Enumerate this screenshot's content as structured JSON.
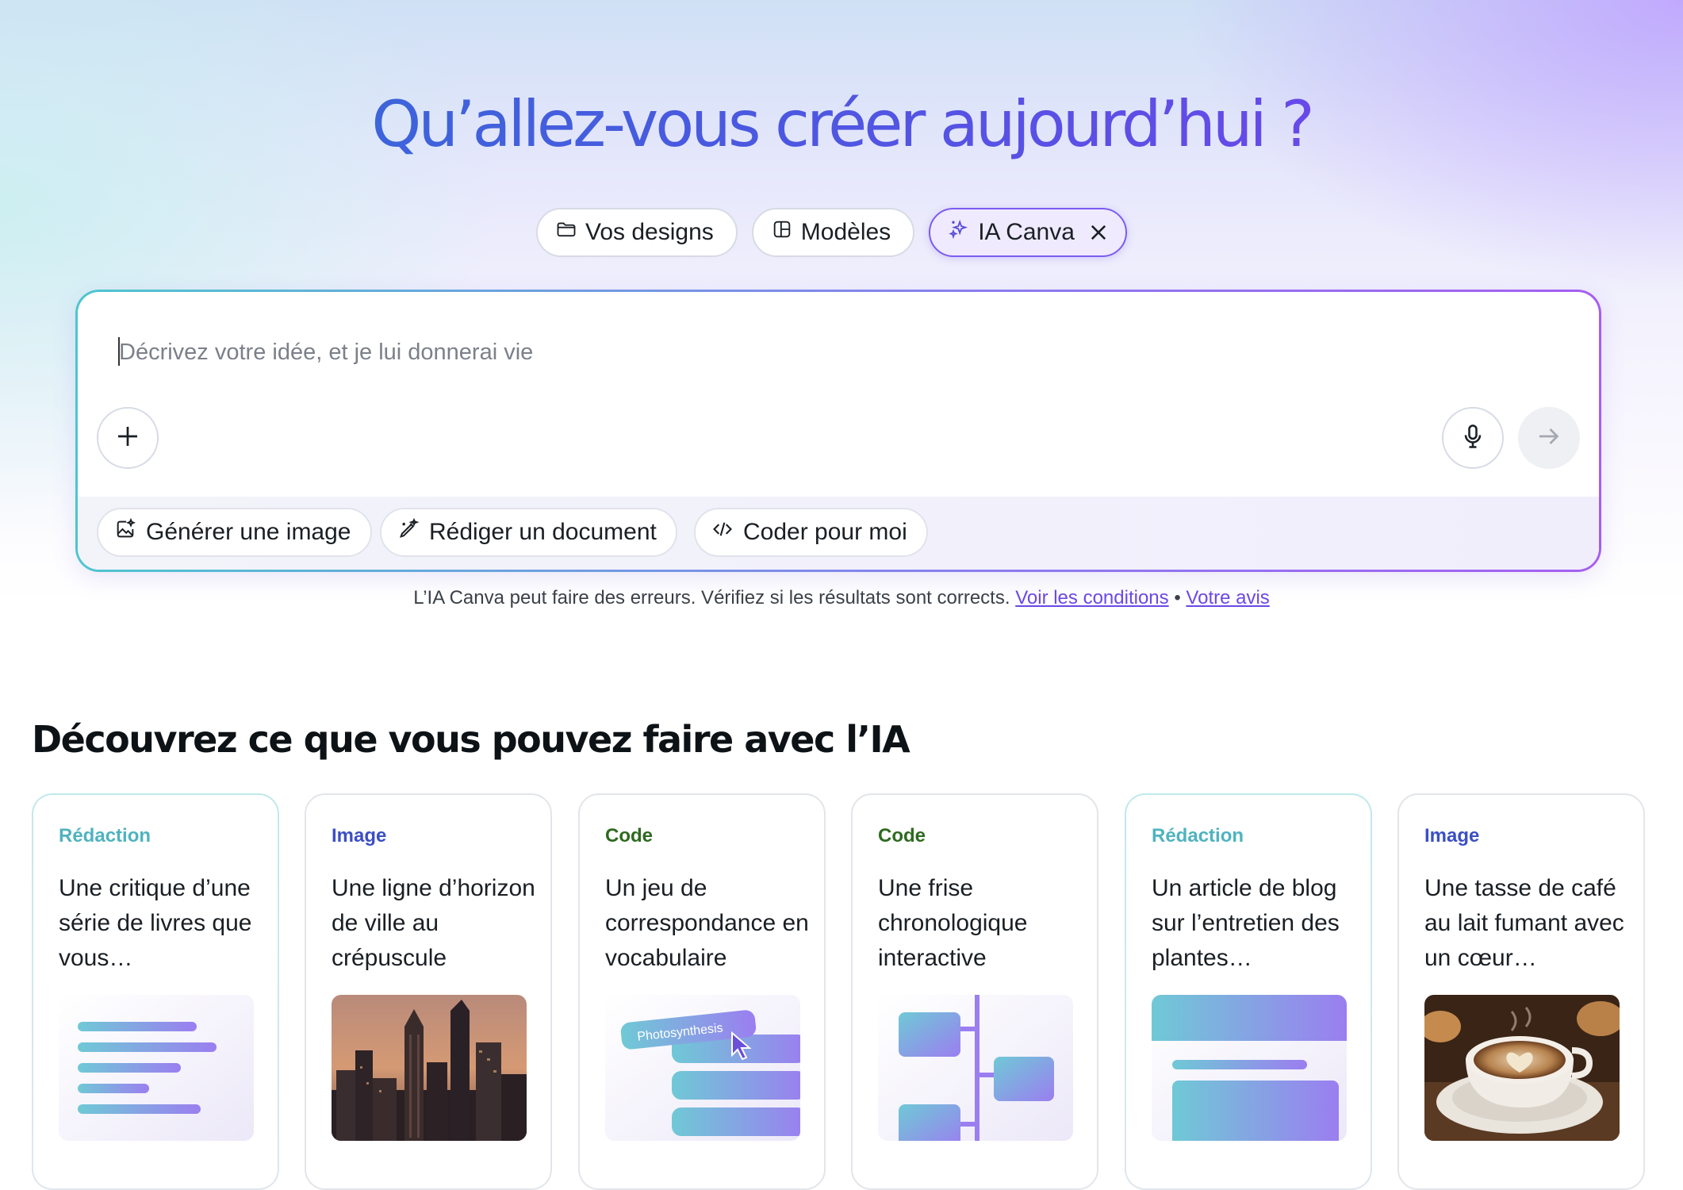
{
  "hero": {
    "title": "Qu’allez-vous créer aujourd’hui ?"
  },
  "tabs": [
    {
      "label": "Vos designs",
      "icon": "folder-icon"
    },
    {
      "label": "Modèles",
      "icon": "template-icon"
    },
    {
      "label": "IA Canva",
      "icon": "sparkle-icon",
      "active": true
    }
  ],
  "prompt": {
    "placeholder": "Décrivez votre idée, et je lui donnerai vie",
    "value": ""
  },
  "suggestions": [
    {
      "label": "Générer une image",
      "icon": "image-sparkle-icon"
    },
    {
      "label": "Rédiger un document",
      "icon": "pen-sparkle-icon"
    },
    {
      "label": "Coder pour moi",
      "icon": "code-icon"
    }
  ],
  "disclaimer": {
    "text": "L’IA Canva peut faire des erreurs. Vérifiez si les résultats sont corrects.",
    "link_terms": "Voir les conditions",
    "separator": "•",
    "link_feedback": "Votre avis"
  },
  "discover": {
    "title": "Découvrez ce que vous pouvez faire avec l’IA",
    "cards": [
      {
        "category": "Rédaction",
        "text": "Une critique d’une série de livres que vous…"
      },
      {
        "category": "Image",
        "text": "Une ligne d’horizon de ville au crépuscule"
      },
      {
        "category": "Code",
        "text": "Un jeu de correspondance en vocabulaire",
        "thumb_label": "Photosynthesis"
      },
      {
        "category": "Code",
        "text": "Une frise chronologique interactive"
      },
      {
        "category": "Rédaction",
        "text": "Un article de blog sur l’entretien des plantes…"
      },
      {
        "category": "Image",
        "text": "Une tasse de café au lait fumant avec un cœur…"
      }
    ]
  },
  "colors": {
    "accent": "#7c5cf0",
    "category_redaction": "#4fb3bf",
    "category_image": "#3b4fc4",
    "category_code": "#2e6a1f"
  }
}
